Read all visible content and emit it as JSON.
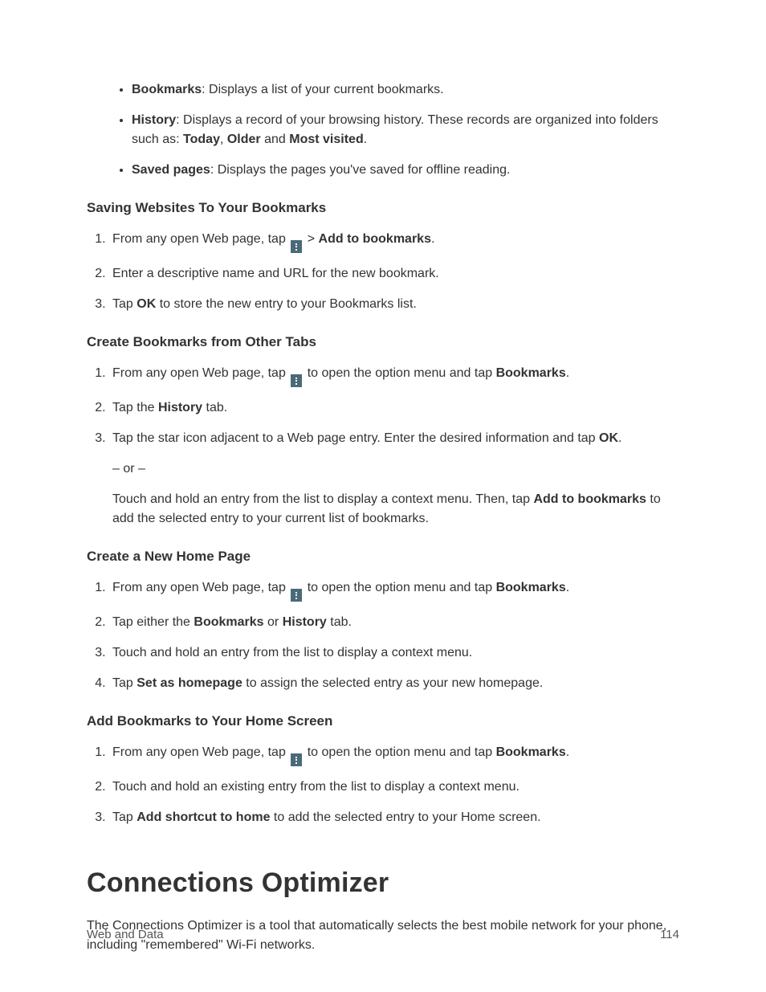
{
  "bullets": [
    {
      "label": "Bookmarks",
      "text": ": Displays a list of your current bookmarks."
    },
    {
      "label": "History",
      "text": ": Displays a record of your browsing history. These records are organized into folders such as: ",
      "extra": [
        {
          "b": "Today"
        },
        {
          "t": ", "
        },
        {
          "b": "Older"
        },
        {
          "t": " and "
        },
        {
          "b": "Most visited"
        },
        {
          "t": "."
        }
      ]
    },
    {
      "label": "Saved pages",
      "text": ": Displays the pages you've saved for offline reading."
    }
  ],
  "sec1": {
    "heading": "Saving Websites To Your Bookmarks",
    "steps": [
      {
        "pre": "From any open Web page, tap ",
        "icon": true,
        "post": " > ",
        "bold": "Add to bookmarks",
        "tail": "."
      },
      {
        "pre": "Enter a descriptive name and URL for the new bookmark."
      },
      {
        "pre": "Tap ",
        "bold": "OK",
        "tail": " to store the new entry to your Bookmarks list."
      }
    ]
  },
  "sec2": {
    "heading": "Create Bookmarks from Other Tabs",
    "steps": [
      {
        "pre": "From any open Web page, tap ",
        "icon": true,
        "post": " to open the option menu and tap ",
        "bold": "Bookmarks",
        "tail": "."
      },
      {
        "pre": "Tap the ",
        "bold": "History",
        "tail": " tab."
      },
      {
        "pre": "Tap the star icon adjacent to a Web page entry. Enter the desired information and tap ",
        "bold": "OK",
        "tail": ".",
        "or": "– or –",
        "extra_pre": "Touch and hold an entry from the list to display a context menu. Then, tap ",
        "extra_bold": "Add to bookmarks",
        "extra_tail": " to add the selected entry to your current list of bookmarks."
      }
    ]
  },
  "sec3": {
    "heading": "Create a New Home Page",
    "steps": [
      {
        "pre": "From any open Web page, tap ",
        "icon": true,
        "post": " to open the option menu and tap ",
        "bold": "Bookmarks",
        "tail": "."
      },
      {
        "pre": "Tap either the ",
        "bold": "Bookmarks",
        "mid": " or ",
        "bold2": "History",
        "tail": " tab."
      },
      {
        "pre": "Touch and hold an entry from the list to display a context menu."
      },
      {
        "pre": "Tap ",
        "bold": "Set as homepage",
        "tail": " to assign the selected entry as your new homepage."
      }
    ]
  },
  "sec4": {
    "heading": "Add Bookmarks to Your Home Screen",
    "steps": [
      {
        "pre": "From any open Web page, tap ",
        "icon": true,
        "post": " to open the option menu and tap ",
        "bold": "Bookmarks",
        "tail": "."
      },
      {
        "pre": "Touch and hold an existing entry from the list to display a context menu."
      },
      {
        "pre": "Tap ",
        "bold": "Add shortcut to home",
        "tail": " to add the selected entry to your Home screen."
      }
    ]
  },
  "h1": "Connections Optimizer",
  "h1_body": "The Connections Optimizer is a tool that automatically selects the best mobile network for your phone, including \"remembered\" Wi-Fi networks.",
  "footer_left": "Web and Data",
  "footer_right": "114"
}
